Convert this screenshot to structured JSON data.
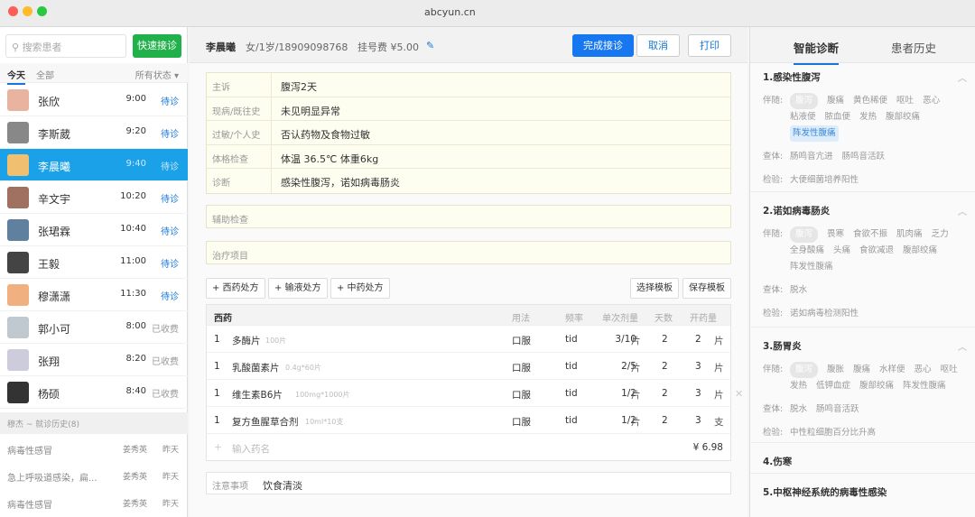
{
  "window": {
    "url": "abcyun.cn"
  },
  "left": {
    "search_placeholder": "搜索患者",
    "quick_button": "快速接诊",
    "tabs": [
      "今天",
      "全部"
    ],
    "status_filter": "所有状态 ▾",
    "patients": [
      {
        "name": "张欣",
        "time": "9:00",
        "status": "待诊"
      },
      {
        "name": "李斯葳",
        "time": "9:20",
        "status": "待诊"
      },
      {
        "name": "李晨曦",
        "time": "9:40",
        "status": "待诊"
      },
      {
        "name": "辛文宇",
        "time": "10:20",
        "status": "待诊"
      },
      {
        "name": "张珺霖",
        "time": "10:40",
        "status": "待诊"
      },
      {
        "name": "王毅",
        "time": "11:00",
        "status": "待诊"
      },
      {
        "name": "穆潇潇",
        "time": "11:30",
        "status": "待诊"
      },
      {
        "name": "郭小可",
        "time": "8:00",
        "status": "已收费"
      },
      {
        "name": "张翔",
        "time": "8:20",
        "status": "已收费"
      },
      {
        "name": "杨硕",
        "time": "8:40",
        "status": "已收费"
      }
    ],
    "history_header": "穆杰 ~ 就诊历史(8)",
    "history": [
      {
        "diagnosis": "病毒性感冒",
        "doctor": "姜秀英",
        "date": "昨天"
      },
      {
        "diagnosis": "急上呼吸道感染，扁...",
        "doctor": "姜秀英",
        "date": "昨天"
      },
      {
        "diagnosis": "病毒性感冒",
        "doctor": "姜秀英",
        "date": "昨天"
      }
    ]
  },
  "header": {
    "name": "李晨曦",
    "info": "女/1岁/18909098768",
    "fee": "挂号费 ¥5.00",
    "complete": "完成接诊",
    "cancel": "取消",
    "print": "打印"
  },
  "record": [
    {
      "label": "主诉",
      "value": "腹泻2天"
    },
    {
      "label": "现病/既往史",
      "value": "未见明显异常"
    },
    {
      "label": "过敏/个人史",
      "value": "否认药物及食物过敏"
    },
    {
      "label": "体格检查",
      "value": "体温 36.5℃   体重6kg"
    },
    {
      "label": "诊断",
      "value": "感染性腹泻，诺如病毒肠炎"
    }
  ],
  "aux_exam": "辅助检查",
  "treatment": "治疗项目",
  "rx_buttons": [
    "+ 西药处方",
    "+ 输液处方",
    "+ 中药处方"
  ],
  "template_select": "选择模板",
  "template_save": "保存模板",
  "rx": {
    "title": "西药",
    "headers": [
      "用法",
      "频率",
      "单次剂量",
      "天数",
      "开药量"
    ],
    "rows": [
      {
        "no": "1",
        "name": "多酶片",
        "spec": "100片",
        "usage": "口服",
        "freq": "tid",
        "dose": "3/10",
        "dose_unit": "片",
        "days": "2",
        "qty": "2",
        "qty_unit": "片"
      },
      {
        "no": "1",
        "name": "乳酸菌素片",
        "spec": "0.4g*60片",
        "usage": "口服",
        "freq": "tid",
        "dose": "2/5",
        "dose_unit": "片",
        "days": "2",
        "qty": "3",
        "qty_unit": "片"
      },
      {
        "no": "1",
        "name": "维生素B6片",
        "spec": "100mg*1000片",
        "usage": "口服",
        "freq": "tid",
        "dose": "1/2",
        "dose_unit": "片",
        "days": "2",
        "qty": "3",
        "qty_unit": "片"
      },
      {
        "no": "1",
        "name": "复方鱼腥草合剂",
        "spec": "10ml*10支",
        "usage": "口服",
        "freq": "tid",
        "dose": "1/2",
        "dose_unit": "片",
        "days": "2",
        "qty": "3",
        "qty_unit": "支"
      }
    ],
    "input_placeholder": "输入药名",
    "total": "¥ 6.98"
  },
  "note": {
    "label": "注意事项",
    "value": "饮食清淡"
  },
  "right": {
    "tabs": [
      "智能诊断",
      "患者历史"
    ],
    "sections": [
      {
        "title": "1.感染性腹泻",
        "accompany_label": "伴随:",
        "pill": "腹泻",
        "tags": [
          "腹痛",
          "黄色稀便",
          "呕吐",
          "恶心",
          "粘液便",
          "脓血便",
          "发热",
          "腹部绞痛",
          "阵发性腹痛"
        ],
        "exam_label": "查体:",
        "exam": [
          "肠鸣音亢进",
          "肠鸣音活跃"
        ],
        "test_label": "检验:",
        "test": [
          "大便细菌培养阳性"
        ]
      },
      {
        "title": "2.诺如病毒肠炎",
        "accompany_label": "伴随:",
        "pill": "腹泻",
        "tags": [
          "畏寒",
          "食欲不振",
          "肌肉痛",
          "乏力",
          "全身酸痛",
          "头痛",
          "食欲减退",
          "腹部绞痛",
          "阵发性腹痛"
        ],
        "exam_label": "查体:",
        "exam": [
          "脱水"
        ],
        "test_label": "检验:",
        "test": [
          "诺如病毒检测阳性"
        ]
      },
      {
        "title": "3.肠胃炎",
        "accompany_label": "伴随:",
        "pill": "腹泻",
        "tags": [
          "腹胀",
          "腹痛",
          "水样便",
          "恶心",
          "呕吐",
          "发热",
          "低钾血症",
          "腹部绞痛",
          "阵发性腹痛"
        ],
        "exam_label": "查体:",
        "exam": [
          "脱水",
          "肠鸣音活跃"
        ],
        "test_label": "检验:",
        "test": [
          "中性粒细胞百分比升高"
        ]
      },
      {
        "title": "4.伤寒"
      },
      {
        "title": "5.中枢神经系统的病毒性感染"
      }
    ]
  },
  "colors": {
    "primary": "#1677f0",
    "green": "#21b14a",
    "selected": "#1aa1e8"
  }
}
